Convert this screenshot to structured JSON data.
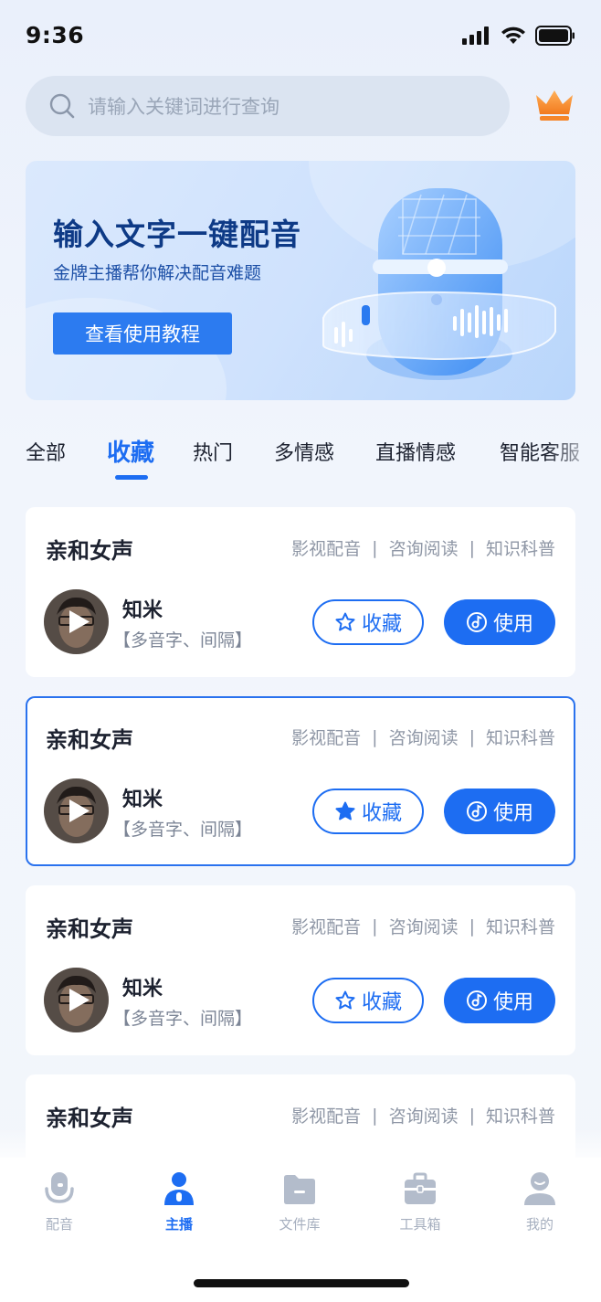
{
  "status_bar": {
    "time": "9:36"
  },
  "search": {
    "placeholder": "请输入关键词进行查询"
  },
  "banner": {
    "title": "输入文字一键配音",
    "subtitle": "金牌主播帮你解决配音难题",
    "button_label": "查看使用教程"
  },
  "tabs": [
    {
      "label": "全部"
    },
    {
      "label": "收藏",
      "active": true
    },
    {
      "label": "热门"
    },
    {
      "label": "多情感"
    },
    {
      "label": "直播情感"
    },
    {
      "label": "智能客服"
    }
  ],
  "cards": [
    {
      "title": "亲和女声",
      "tags": [
        "影视配音",
        "咨询阅读",
        "知识科普"
      ],
      "voice_name": "知米",
      "voice_desc": "【多音字、间隔】",
      "favorite_label": "收藏",
      "favorited": false,
      "use_label": "使用"
    },
    {
      "title": "亲和女声",
      "tags": [
        "影视配音",
        "咨询阅读",
        "知识科普"
      ],
      "voice_name": "知米",
      "voice_desc": "【多音字、间隔】",
      "favorite_label": "收藏",
      "favorited": true,
      "use_label": "使用"
    },
    {
      "title": "亲和女声",
      "tags": [
        "影视配音",
        "咨询阅读",
        "知识科普"
      ],
      "voice_name": "知米",
      "voice_desc": "【多音字、间隔】",
      "favorite_label": "收藏",
      "favorited": false,
      "use_label": "使用"
    },
    {
      "title": "亲和女声",
      "tags": [
        "影视配音",
        "咨询阅读",
        "知识科普"
      ]
    }
  ],
  "bottom_nav": [
    {
      "label": "配音",
      "icon": "microphone-icon"
    },
    {
      "label": "主播",
      "icon": "person-icon",
      "active": true
    },
    {
      "label": "文件库",
      "icon": "folder-icon"
    },
    {
      "label": "工具箱",
      "icon": "toolbox-icon"
    },
    {
      "label": "我的",
      "icon": "profile-icon"
    }
  ],
  "colors": {
    "accent": "#1d6df2",
    "banner_title": "#0e3a86",
    "muted": "#8f97a6"
  }
}
